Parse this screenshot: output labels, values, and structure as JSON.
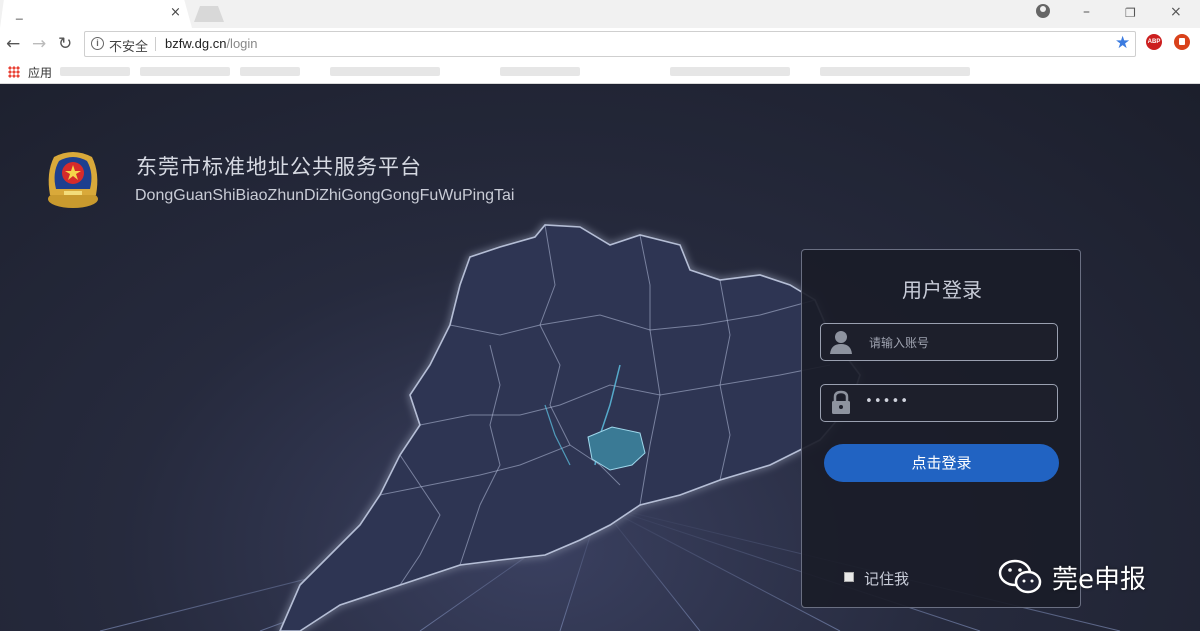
{
  "browser": {
    "tab_title": "_",
    "tab_close": "×",
    "window_controls": {
      "minimize": "–",
      "restore": "❐",
      "close": "×"
    },
    "nav": {
      "back": "←",
      "forward": "→",
      "reload": "↻"
    },
    "address": {
      "security_label": "不安全",
      "host": "bzfw.dg.cn",
      "path": "/login"
    },
    "bookmarks": {
      "apps_label": "应用"
    },
    "extensions": {
      "abp_label": "ABP"
    }
  },
  "page": {
    "title": "东莞市标准地址公共服务平台",
    "subtitle": "DongGuanShiBiaoZhunDiZhiGongGongFuWuPingTai",
    "login": {
      "title": "用户登录",
      "username_placeholder": "请输入账号",
      "password_value": "•••••",
      "submit_label": "点击登录",
      "remember_label": "记住我"
    }
  },
  "watermark": {
    "text": "莞e申报"
  },
  "colors": {
    "accent": "#2163c2",
    "highlight_region": "#3a7a95",
    "card_border": "#6a6f82"
  }
}
